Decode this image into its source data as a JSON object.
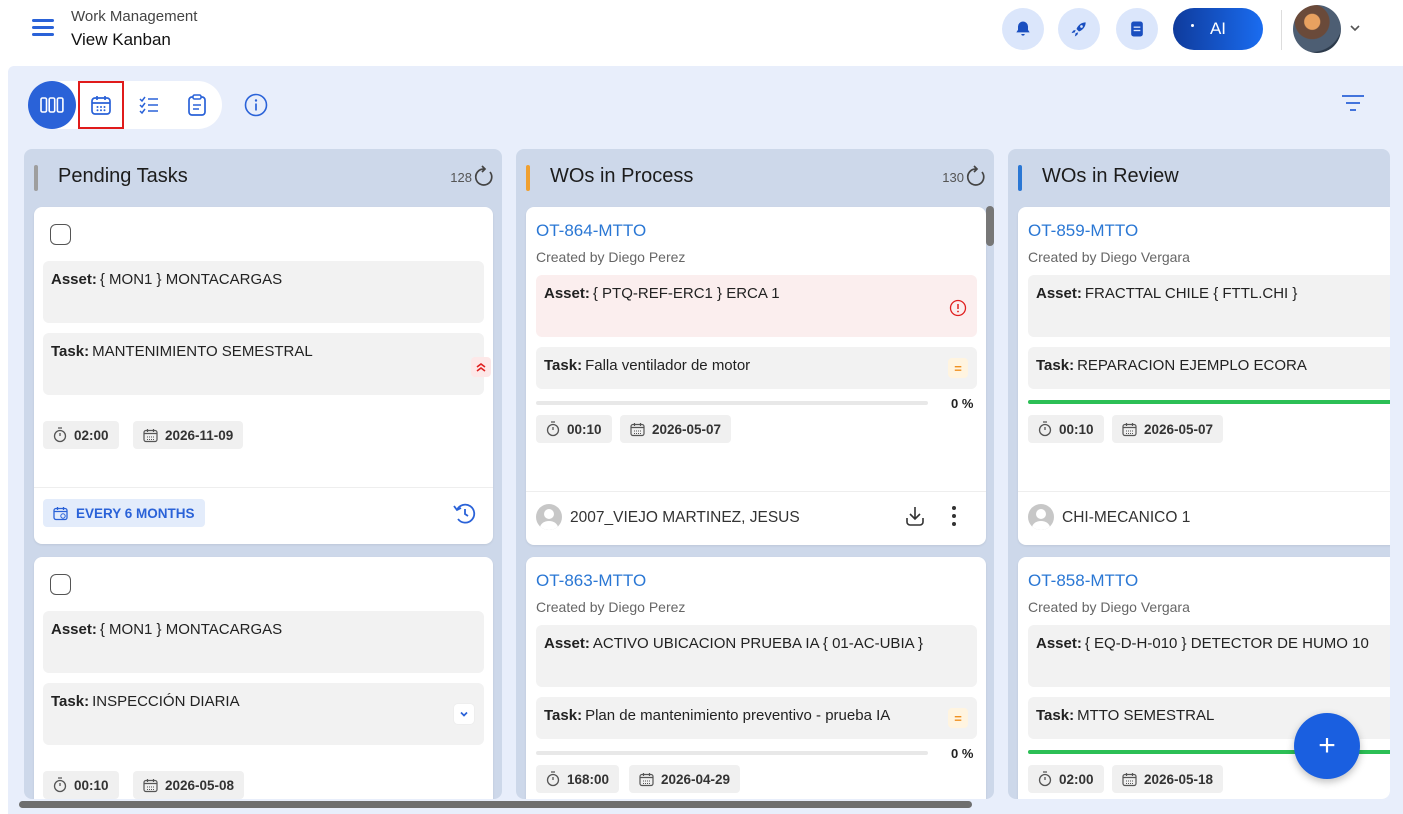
{
  "header": {
    "module": "Work Management",
    "view": "View Kanban",
    "ai_label": "AI"
  },
  "toolbar": {
    "views": [
      "kanban-view",
      "calendar-view",
      "checklist-view",
      "clipboard-view"
    ],
    "active_view": "kanban-view",
    "highlighted_view": "calendar-view"
  },
  "columns": [
    {
      "title": "Pending Tasks",
      "count": "128",
      "color": "#9e9e9e",
      "cards": [
        {
          "asset_label": "Asset:",
          "asset": "{ MON1 } MONTACARGAS",
          "task_label": "Task:",
          "task": "MANTENIMIENTO SEMESTRAL",
          "priority": "high",
          "duration": "02:00",
          "date": "2026-11-09",
          "recurrence": "EVERY 6 MONTHS"
        },
        {
          "asset_label": "Asset:",
          "asset": "{ MON1 } MONTACARGAS",
          "task_label": "Task:",
          "task": "INSPECCIÓN DIARIA",
          "priority": "low",
          "duration": "00:10",
          "date": "2026-05-08"
        }
      ]
    },
    {
      "title": "WOs in Process",
      "count": "130",
      "color": "#f0a030",
      "cards": [
        {
          "code": "OT-864-MTTO",
          "created_by": "Created by Diego Perez",
          "asset_label": "Asset:",
          "asset": "{ PTQ-REF-ERC1 } ERCA 1",
          "task_label": "Task:",
          "task": "Falla ventilador de motor",
          "priority": "medium",
          "progress": "0 %",
          "progress_value": 0,
          "duration": "00:10",
          "date": "2026-05-07",
          "assignee": "2007_VIEJO MARTINEZ, JESUS"
        },
        {
          "code": "OT-863-MTTO",
          "created_by": "Created by Diego Perez",
          "asset_label": "Asset:",
          "asset": "ACTIVO UBICACION PRUEBA IA { 01-AC-UBIA }",
          "task_label": "Task:",
          "task": "Plan de mantenimiento preventivo - prueba IA",
          "priority": "medium",
          "progress": "0 %",
          "progress_value": 0,
          "duration": "168:00",
          "date": "2026-04-29"
        }
      ]
    },
    {
      "title": "WOs in Review",
      "color": "#2a77d4",
      "cards": [
        {
          "code": "OT-859-MTTO",
          "created_by": "Created by Diego Vergara",
          "asset_label": "Asset:",
          "asset": "FRACTTAL CHILE { FTTL.CHI }",
          "task_label": "Task:",
          "task": "REPARACION EJEMPLO ECORA",
          "progress_value": 100,
          "duration": "00:10",
          "date": "2026-05-07",
          "assignee": "CHI-MECANICO 1"
        },
        {
          "code": "OT-858-MTTO",
          "created_by": "Created by Diego Vergara",
          "asset_label": "Asset:",
          "asset": "{ EQ-D-H-010 } DETECTOR DE HUMO 10",
          "task_label": "Task:",
          "task": "MTTO SEMESTRAL",
          "progress_value": 100,
          "duration": "02:00",
          "date": "2026-05-18"
        }
      ]
    }
  ],
  "fab_label": "+"
}
